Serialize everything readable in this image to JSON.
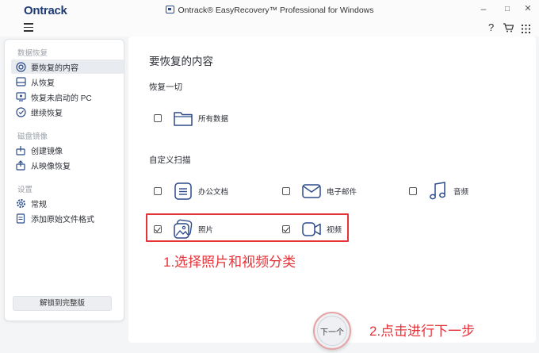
{
  "app": {
    "brand": "Ontrack",
    "window_title": "Ontrack® EasyRecovery™ Professional for Windows"
  },
  "window_controls": {
    "minimize": "–",
    "maximize": "□",
    "close": "✕"
  },
  "toolbar": {
    "help": "?",
    "cart_icon": "cart-icon",
    "grid_icon": "grid-icon"
  },
  "sidebar": {
    "sections": [
      {
        "title": "数据恢复",
        "items": [
          {
            "label": "要恢复的内容",
            "icon": "target-icon",
            "active": true
          },
          {
            "label": "从恢复",
            "icon": "drive-icon",
            "active": false
          },
          {
            "label": "恢复未启动的 PC",
            "icon": "monitor-icon",
            "active": false
          },
          {
            "label": "继续恢复",
            "icon": "resume-icon",
            "active": false
          }
        ]
      },
      {
        "title": "磁盘镜像",
        "items": [
          {
            "label": "创建镜像",
            "icon": "create-image-icon",
            "active": false
          },
          {
            "label": "从映像恢复",
            "icon": "restore-image-icon",
            "active": false
          }
        ]
      },
      {
        "title": "设置",
        "items": [
          {
            "label": "常规",
            "icon": "gear-icon",
            "active": false
          },
          {
            "label": "添加原始文件格式",
            "icon": "file-format-icon",
            "active": false
          }
        ]
      }
    ],
    "unlock_label": "解锁到完整版"
  },
  "main": {
    "title": "要恢复的内容",
    "recover_all": {
      "heading": "恢复一切",
      "options": [
        {
          "label": "所有数据",
          "checked": false,
          "icon": "folder-icon"
        }
      ]
    },
    "custom_scan": {
      "heading": "自定义扫描",
      "options": [
        {
          "label": "办公文档",
          "checked": false,
          "icon": "document-icon"
        },
        {
          "label": "电子邮件",
          "checked": false,
          "icon": "mail-icon"
        },
        {
          "label": "音频",
          "checked": false,
          "icon": "music-icon"
        },
        {
          "label": "照片",
          "checked": true,
          "icon": "photo-icon"
        },
        {
          "label": "视频",
          "checked": true,
          "icon": "video-icon"
        }
      ]
    },
    "next_label": "下一个"
  },
  "annotations": {
    "step1": "1.选择照片和视频分类",
    "step2": "2.点击进行下一步"
  },
  "colors": {
    "brand": "#1f3b73",
    "accent_icon": "#2b4a8a",
    "annotation": "#e5333a"
  }
}
